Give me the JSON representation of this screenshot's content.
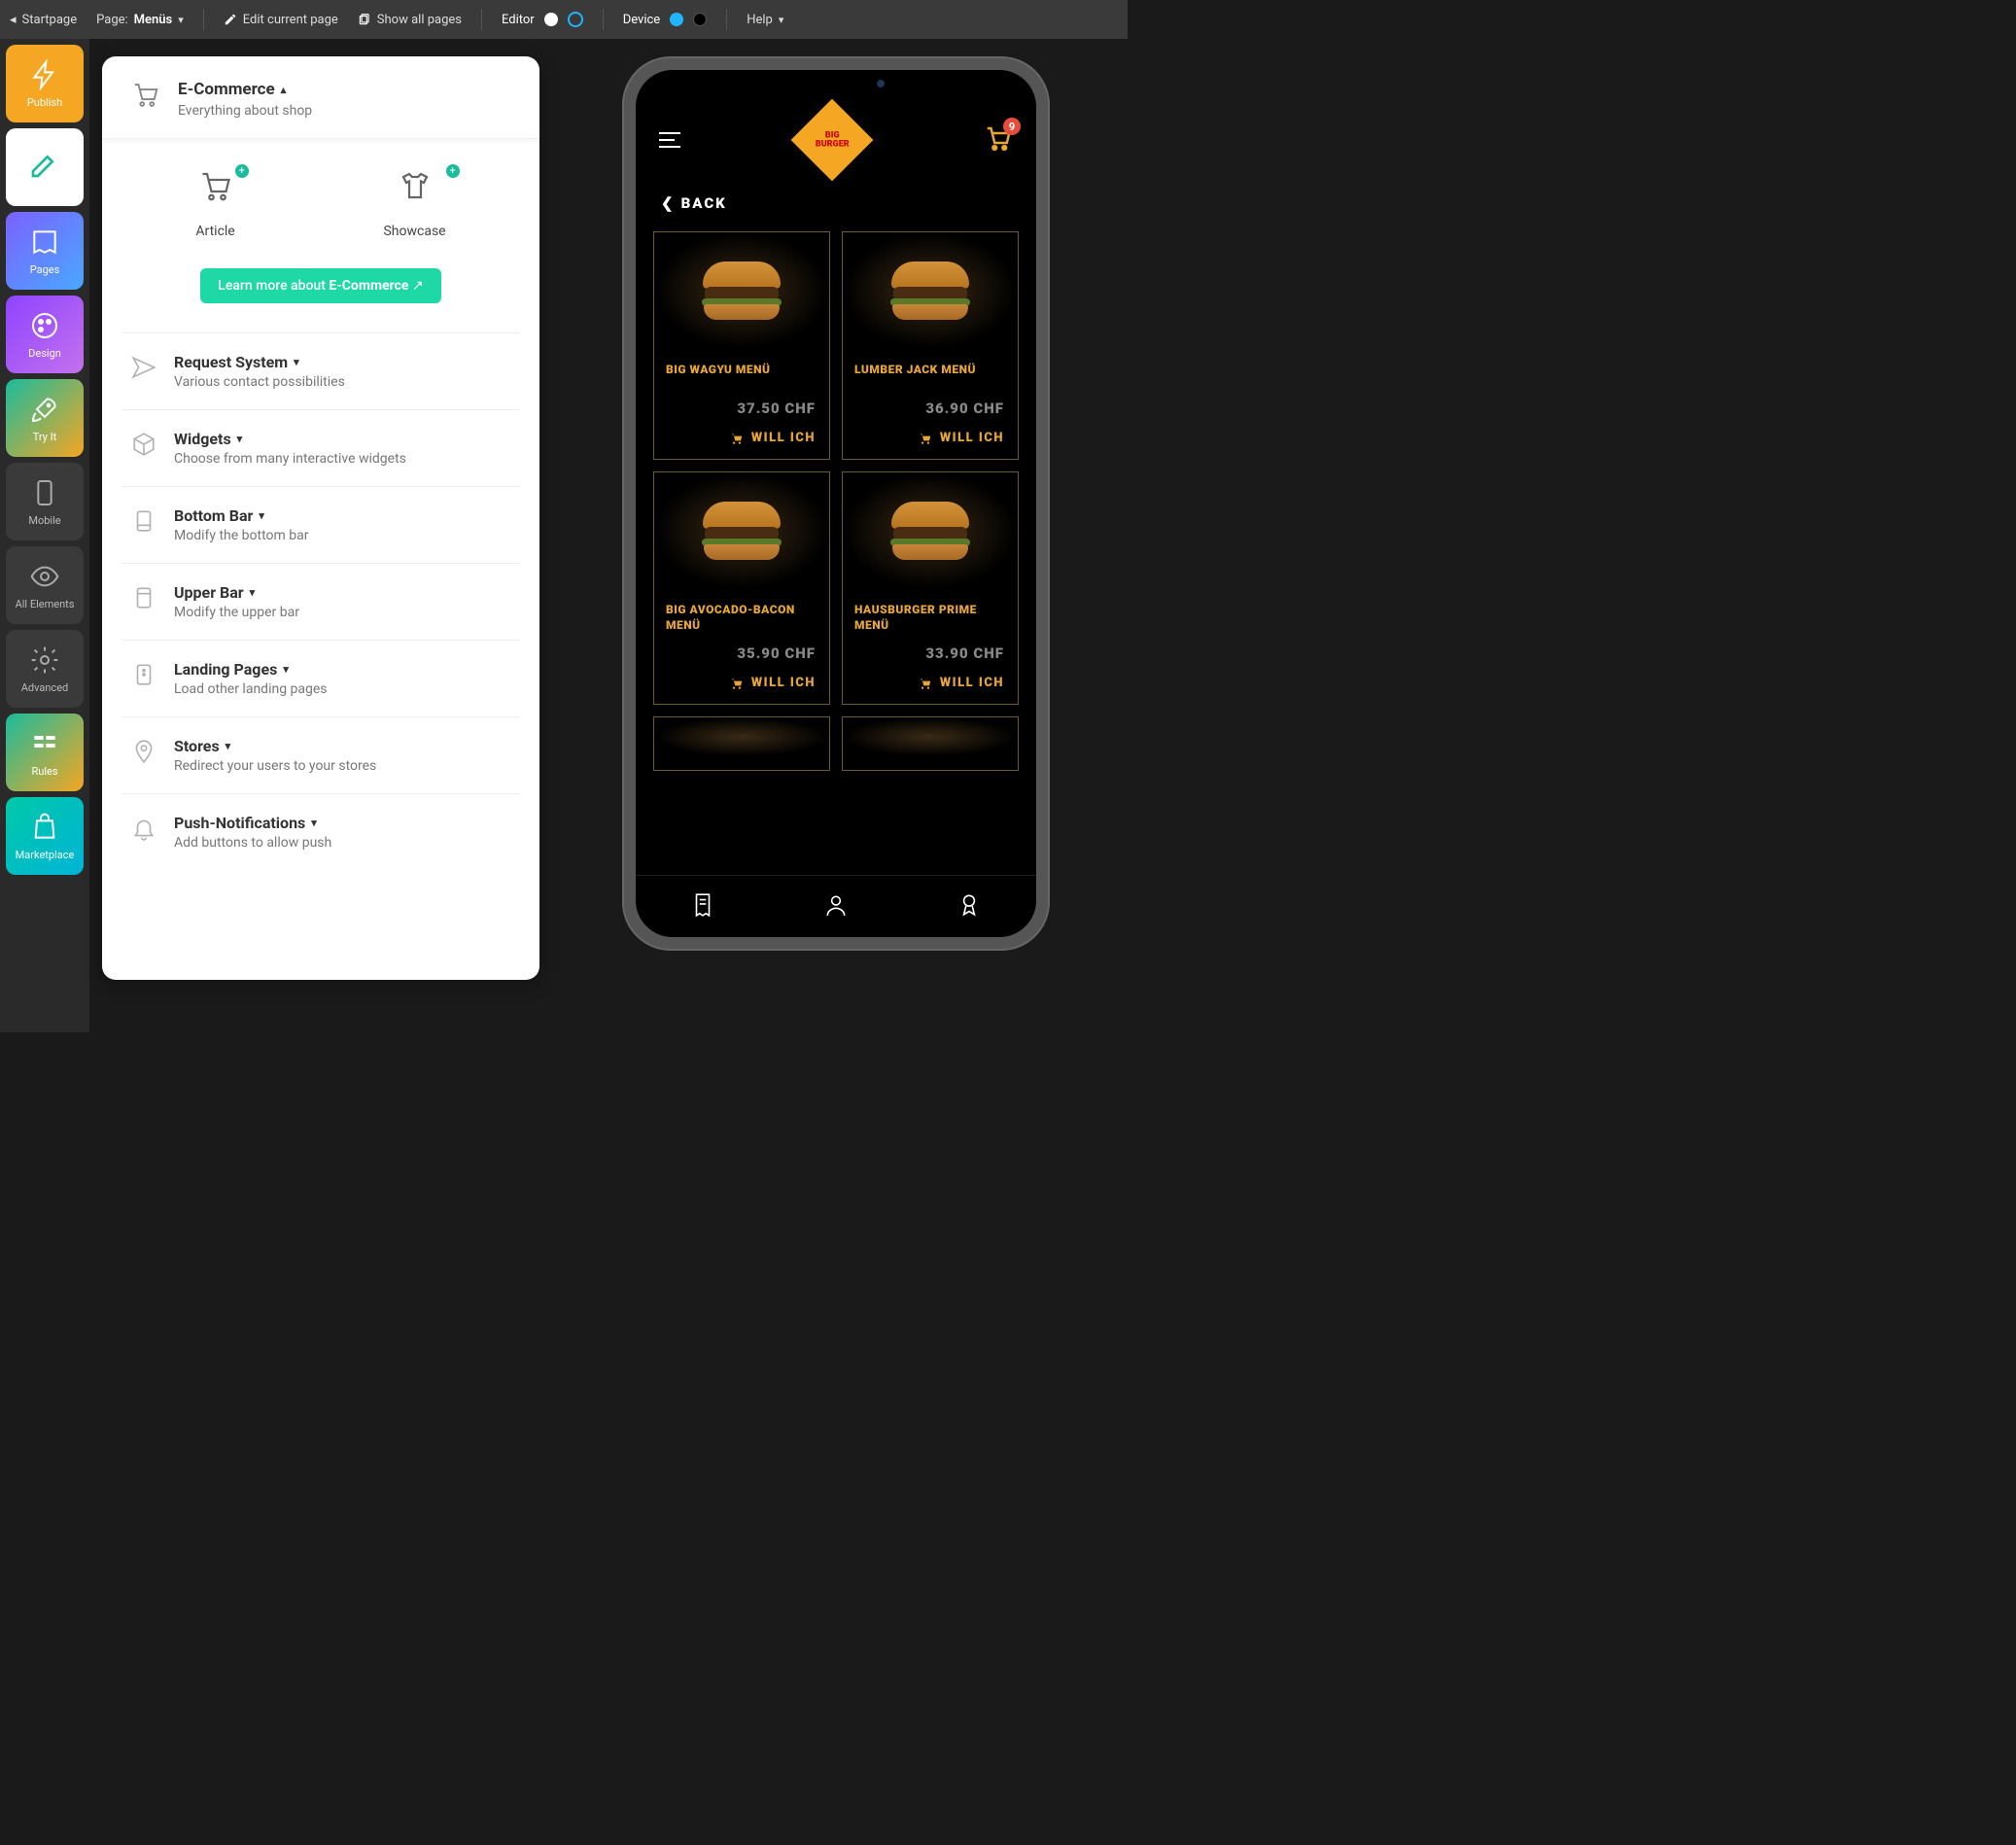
{
  "topbar": {
    "startpage": "Startpage",
    "page_label": "Page:",
    "page_name": "Menüs",
    "edit_page": "Edit current page",
    "show_all": "Show all pages",
    "editor": "Editor",
    "device": "Device",
    "help": "Help"
  },
  "rail": {
    "publish": "Publish",
    "edit": "",
    "pages": "Pages",
    "design": "Design",
    "tryit": "Try It",
    "mobile": "Mobile",
    "allelements": "All Elements",
    "advanced": "Advanced",
    "rules": "Rules",
    "marketplace": "Marketplace"
  },
  "panel": {
    "header": {
      "title": "E-Commerce",
      "subtitle": "Everything about shop"
    },
    "widgets": {
      "article": "Article",
      "showcase": "Showcase"
    },
    "learn_prefix": "Learn more about ",
    "learn_strong": "E-Commerce",
    "sections": [
      {
        "title": "Request System",
        "sub": "Various contact possibilities"
      },
      {
        "title": "Widgets",
        "sub": "Choose from many interactive widgets"
      },
      {
        "title": "Bottom Bar",
        "sub": "Modify the bottom bar"
      },
      {
        "title": "Upper Bar",
        "sub": "Modify the upper bar"
      },
      {
        "title": "Landing Pages",
        "sub": "Load other landing pages"
      },
      {
        "title": "Stores",
        "sub": "Redirect your users to your stores"
      },
      {
        "title": "Push-Notifications",
        "sub": "Add buttons to allow push"
      }
    ]
  },
  "app": {
    "brand_line1": "BIG",
    "brand_line2": "BURGER",
    "cart_count": "9",
    "back": "BACK",
    "cta": "WILL ICH",
    "items": [
      {
        "name": "BIG WAGYU MENÜ",
        "price": "37.50 CHF"
      },
      {
        "name": "LUMBER JACK MENÜ",
        "price": "36.90 CHF"
      },
      {
        "name": "BIG AVOCADO-BACON MENÜ",
        "price": "35.90 CHF"
      },
      {
        "name": "HAUSBURGER PRIME MENÜ",
        "price": "33.90 CHF"
      }
    ]
  }
}
